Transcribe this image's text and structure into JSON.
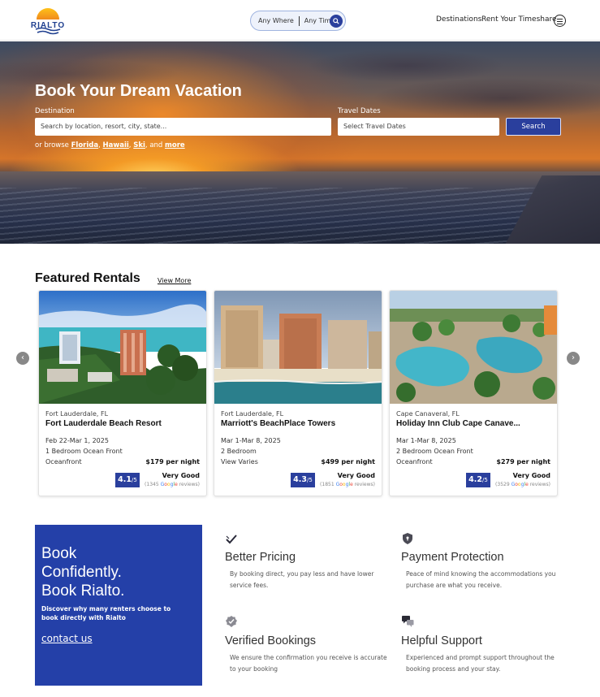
{
  "nav": {
    "logo_text": "RIALTO",
    "where": "Any Where",
    "time": "Any Time",
    "links": [
      "Destinations",
      "Rent Your Timeshare"
    ]
  },
  "hero": {
    "title": "Book Your Dream Vacation",
    "destination_label": "Destination",
    "destination_placeholder": "Search by location, resort, city, state...",
    "dates_label": "Travel Dates",
    "dates_placeholder": "Select Travel Dates",
    "search_label": "Search",
    "browse_prefix": "or browse",
    "browse_links": [
      "Florida",
      "Hawaii",
      "Ski"
    ],
    "browse_and": "and",
    "browse_more": "more"
  },
  "featured": {
    "title": "Featured Rentals",
    "view_more": "View More",
    "cards": [
      {
        "location": "Fort Lauderdale, FL",
        "name": "Fort Lauderdale Beach Resort",
        "dates": "Feb 22-Mar 1, 2025",
        "room": "1 Bedroom Ocean Front",
        "view": "Oceanfront",
        "price": "$179 per night",
        "score": "4.1",
        "score_suffix": "/5",
        "rating_label": "Very Good",
        "reviews_count": "(1345",
        "reviews_suffix": "reviews)"
      },
      {
        "location": "Fort Lauderdale, FL",
        "name": "Marriott's BeachPlace Towers",
        "dates": "Mar 1-Mar 8, 2025",
        "room": "2 Bedroom",
        "view": "View Varies",
        "price": "$499 per night",
        "score": "4.3",
        "score_suffix": "/5",
        "rating_label": "Very Good",
        "reviews_count": "(1851",
        "reviews_suffix": "reviews)"
      },
      {
        "location": "Cape Canaveral, FL",
        "name": "Holiday Inn Club Cape Canave...",
        "dates": "Mar 1-Mar 8, 2025",
        "room": "2 Bedroom Ocean Front",
        "view": "Oceanfront",
        "price": "$279 per night",
        "score": "4.2",
        "score_suffix": "/5",
        "rating_label": "Very Good",
        "reviews_count": "(3529",
        "reviews_suffix": "reviews)"
      }
    ]
  },
  "confidence": {
    "heading_lines": [
      "Book",
      "Confidently.",
      "Book Rialto."
    ],
    "sub": "Discover why many renters choose to book directly with Rialto",
    "link": "contact us"
  },
  "features": [
    {
      "icon": "checkmark-icon",
      "title": "Better Pricing",
      "text": "By booking direct, you pay less and have lower service fees."
    },
    {
      "icon": "shield-lock-icon",
      "title": "Payment Protection",
      "text": "Peace of mind knowing the accommodations you purchase are what you receive."
    },
    {
      "icon": "verified-badge-icon",
      "title": "Verified Bookings",
      "text": "We ensure the confirmation you receive is accurate to your booking"
    },
    {
      "icon": "chat-bubbles-icon",
      "title": "Helpful Support",
      "text": "Experienced and prompt support throughout the booking process and your stay."
    }
  ],
  "colors": {
    "brand_blue": "#2a3f9d",
    "box_blue": "#2440a8"
  }
}
